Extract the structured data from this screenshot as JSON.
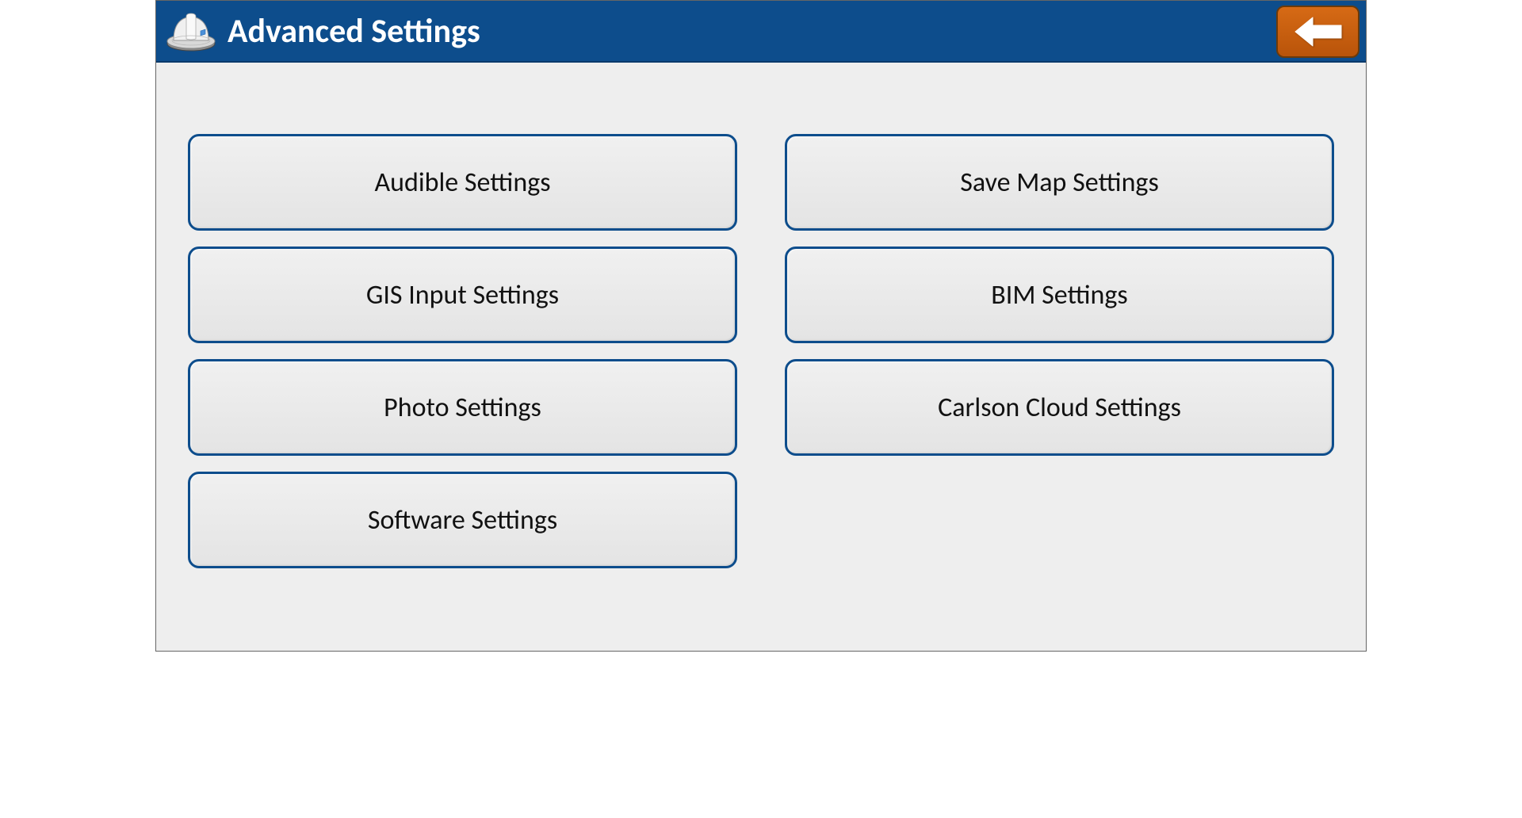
{
  "header": {
    "title": "Advanced Settings"
  },
  "left_column": [
    {
      "label": "Audible Settings",
      "name": "audible-settings-button"
    },
    {
      "label": "GIS Input Settings",
      "name": "gis-input-settings-button"
    },
    {
      "label": "Photo Settings",
      "name": "photo-settings-button"
    },
    {
      "label": "Software Settings",
      "name": "software-settings-button"
    }
  ],
  "right_column": [
    {
      "label": "Save Map Settings",
      "name": "save-map-settings-button"
    },
    {
      "label": "BIM Settings",
      "name": "bim-settings-button"
    },
    {
      "label": "Carlson Cloud Settings",
      "name": "carlson-cloud-settings-button"
    }
  ]
}
